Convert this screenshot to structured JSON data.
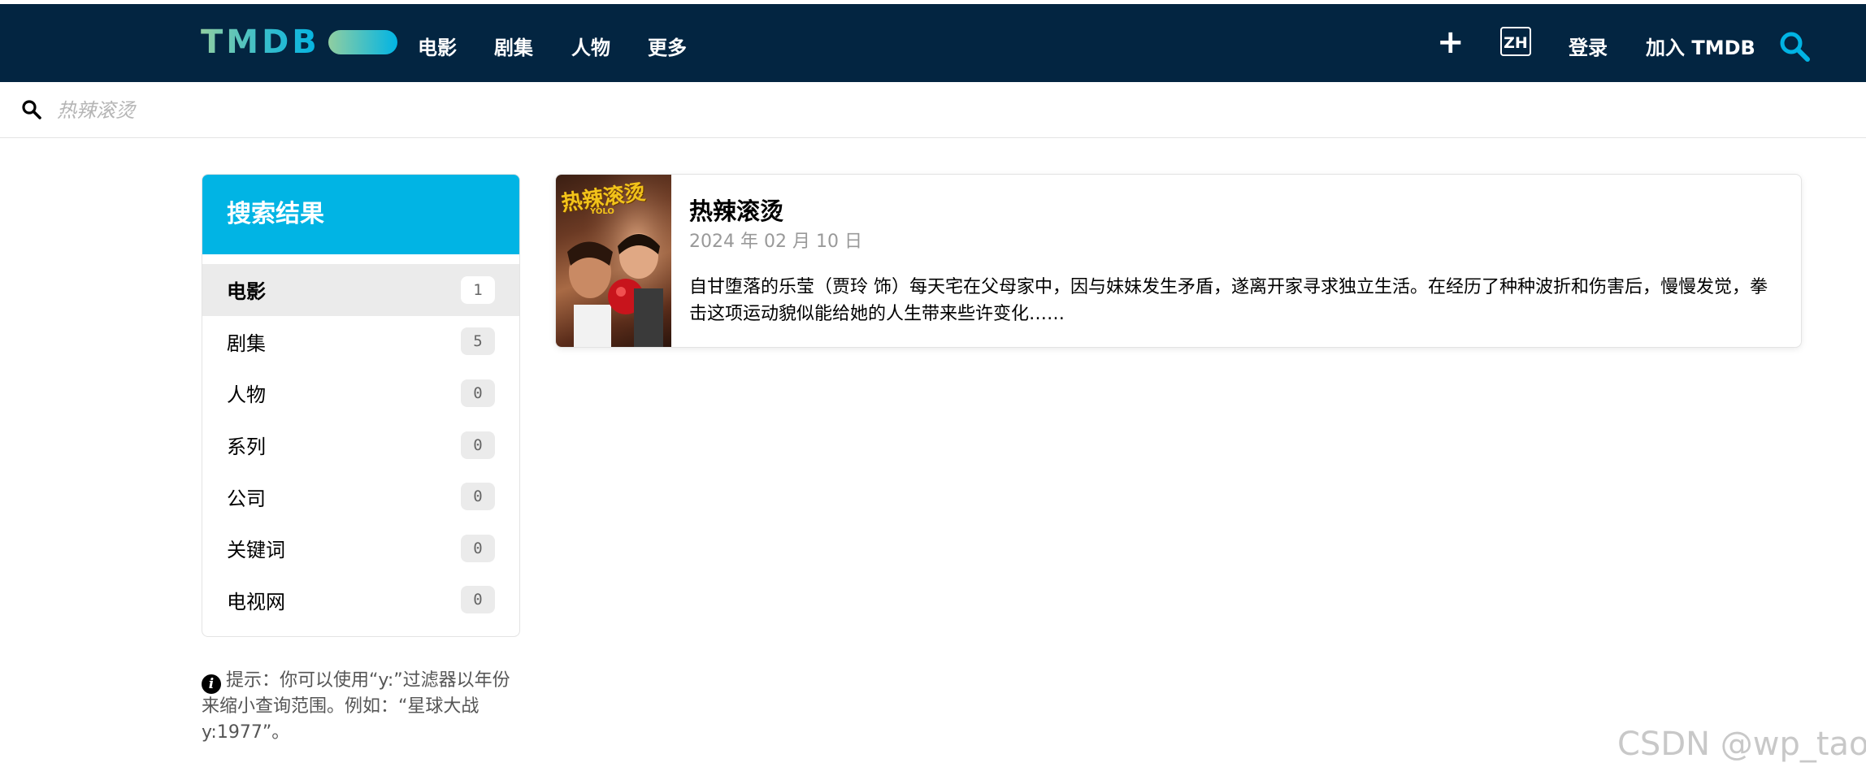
{
  "header": {
    "logo_text": "TMDB",
    "nav": [
      "电影",
      "剧集",
      "人物",
      "更多"
    ],
    "add_icon": "plus-icon",
    "language": "ZH",
    "login": "登录",
    "join": "加入 TMDB",
    "search_icon": "search-icon",
    "background_color": "#032541",
    "accent_color": "#01b4e4"
  },
  "search": {
    "value": "",
    "placeholder": "热辣滚烫",
    "icon": "search-icon"
  },
  "sidebar": {
    "title": "搜索结果",
    "categories": [
      {
        "label": "电影",
        "count": "1",
        "active": true
      },
      {
        "label": "剧集",
        "count": "5"
      },
      {
        "label": "人物",
        "count": "0"
      },
      {
        "label": "系列",
        "count": "0"
      },
      {
        "label": "公司",
        "count": "0"
      },
      {
        "label": "关键词",
        "count": "0"
      },
      {
        "label": "电视网",
        "count": "0"
      }
    ],
    "tip": "提示：你可以使用“y:”过滤器以年份来缩小查询范围。例如：“星球大战 y:1977”。",
    "tip_icon": "info-icon"
  },
  "results": [
    {
      "title": "热辣滚烫",
      "date": "2024 年 02 月 10 日",
      "overview": "自甘堕落的乐莹（贾玲 饰）每天宅在父母家中，因与妹妹发生矛盾，遂离开家寻求独立生活。在经历了种种波折和伤害后，慢慢发觉，拳击这项运动貌似能给她的人生带来些许变化……",
      "poster_title": "热辣滚烫",
      "poster_subtitle": "YOLO"
    }
  ],
  "watermark": "CSDN @wp_tao"
}
